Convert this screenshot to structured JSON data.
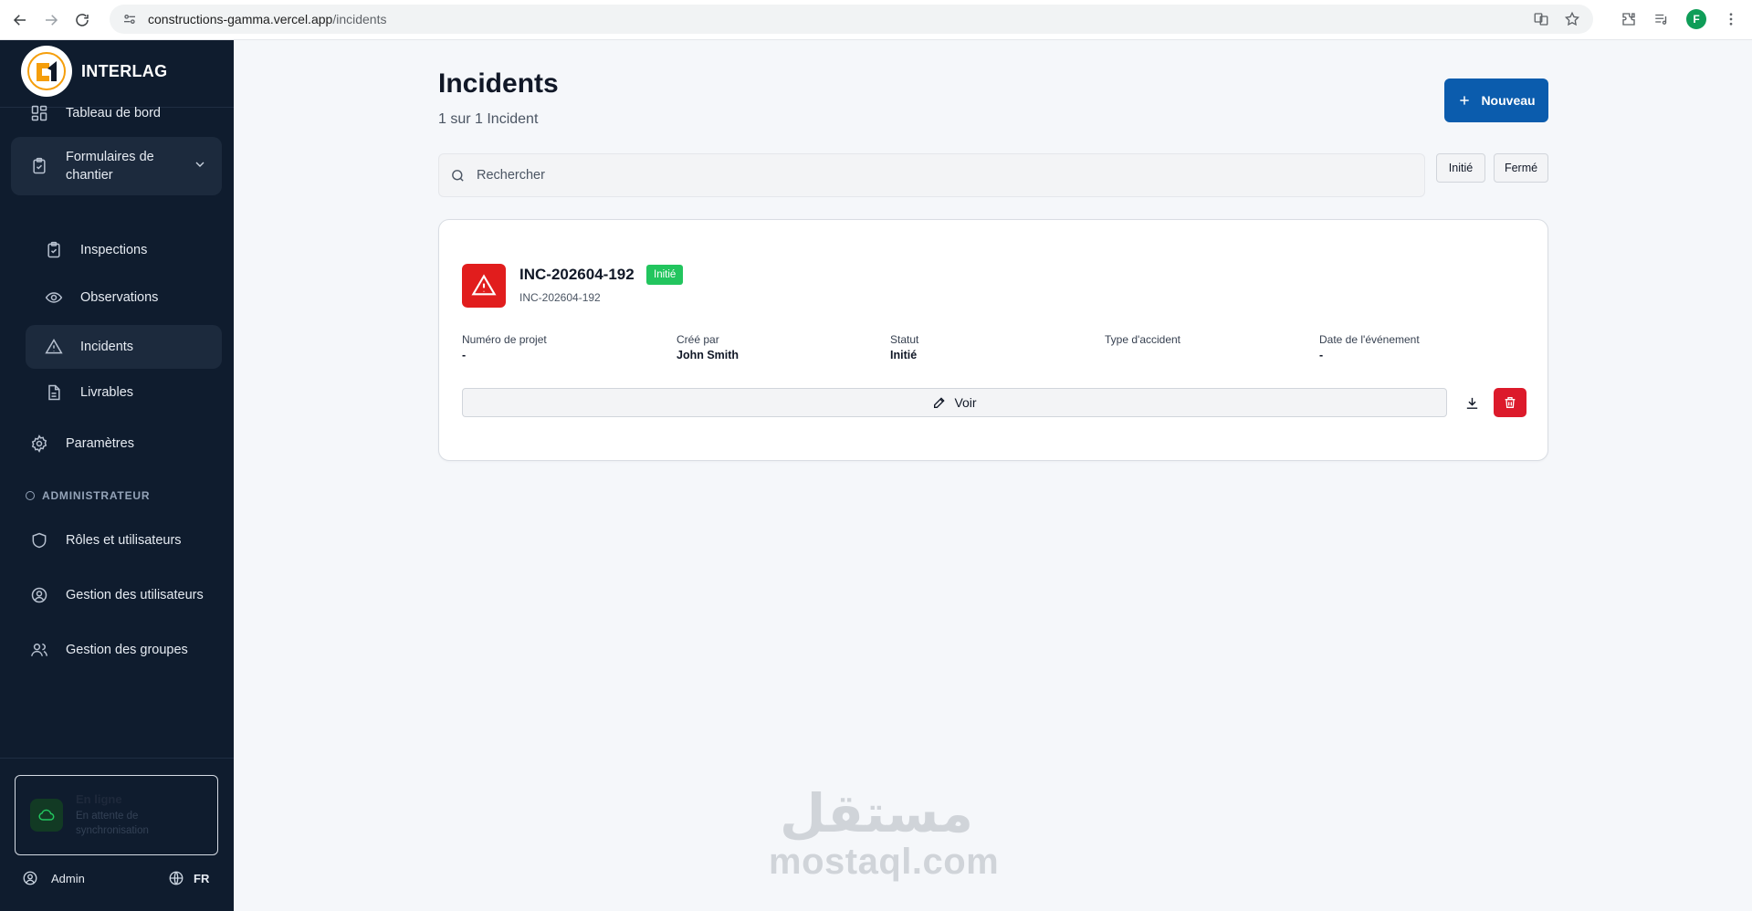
{
  "browser": {
    "url_host": "constructions-gamma.vercel.app",
    "url_path": "/incidents",
    "profile_initial": "F"
  },
  "sidebar": {
    "brand": "INTERLAG",
    "items": [
      {
        "label": "Tableau de bord",
        "icon": "dashboard-icon"
      },
      {
        "label": "Formulaires de chantier",
        "icon": "clipboard-check-icon"
      },
      {
        "label": "Inspections",
        "icon": "clipboard-check-icon"
      },
      {
        "label": "Observations",
        "icon": "eye-icon"
      },
      {
        "label": "Incidents",
        "icon": "warning-icon"
      },
      {
        "label": "Livrables",
        "icon": "file-icon"
      },
      {
        "label": "Paramètres",
        "icon": "gear-icon"
      }
    ],
    "admin_label": "ADMINISTRATEUR",
    "admin_items": [
      {
        "label": "Rôles et utilisateurs",
        "icon": "shield-icon"
      },
      {
        "label": "Gestion des utilisateurs",
        "icon": "user-circle-icon"
      },
      {
        "label": "Gestion des groupes",
        "icon": "users-icon"
      }
    ],
    "status": {
      "title": "En ligne",
      "subtitle": "En attente de synchronisation"
    },
    "user": "Admin",
    "language": "FR"
  },
  "main": {
    "title": "Incidents",
    "subtitle": "1 sur 1 Incident",
    "new_button": "Nouveau",
    "search_placeholder": "Rechercher",
    "filters": [
      "Initié",
      "Fermé"
    ],
    "incidents": [
      {
        "id": "INC-202604-192",
        "code": "INC-202604-192",
        "status_badge": "Initié",
        "fields": [
          {
            "label": "Numéro de projet",
            "value": "-"
          },
          {
            "label": "Créé par",
            "value": "John Smith"
          },
          {
            "label": "Statut",
            "value": "Initié"
          },
          {
            "label": "Type d'accident",
            "value": ""
          },
          {
            "label": "Date de l'événement",
            "value": "-"
          }
        ],
        "view_button": "Voir"
      }
    ]
  },
  "watermark": {
    "arabic": "مستقل",
    "latin": "mostaql.com"
  },
  "colors": {
    "sidebar_bg": "#0f1c2e",
    "primary": "#0b5cad",
    "danger": "#dc1a2b",
    "success": "#22c55e"
  }
}
